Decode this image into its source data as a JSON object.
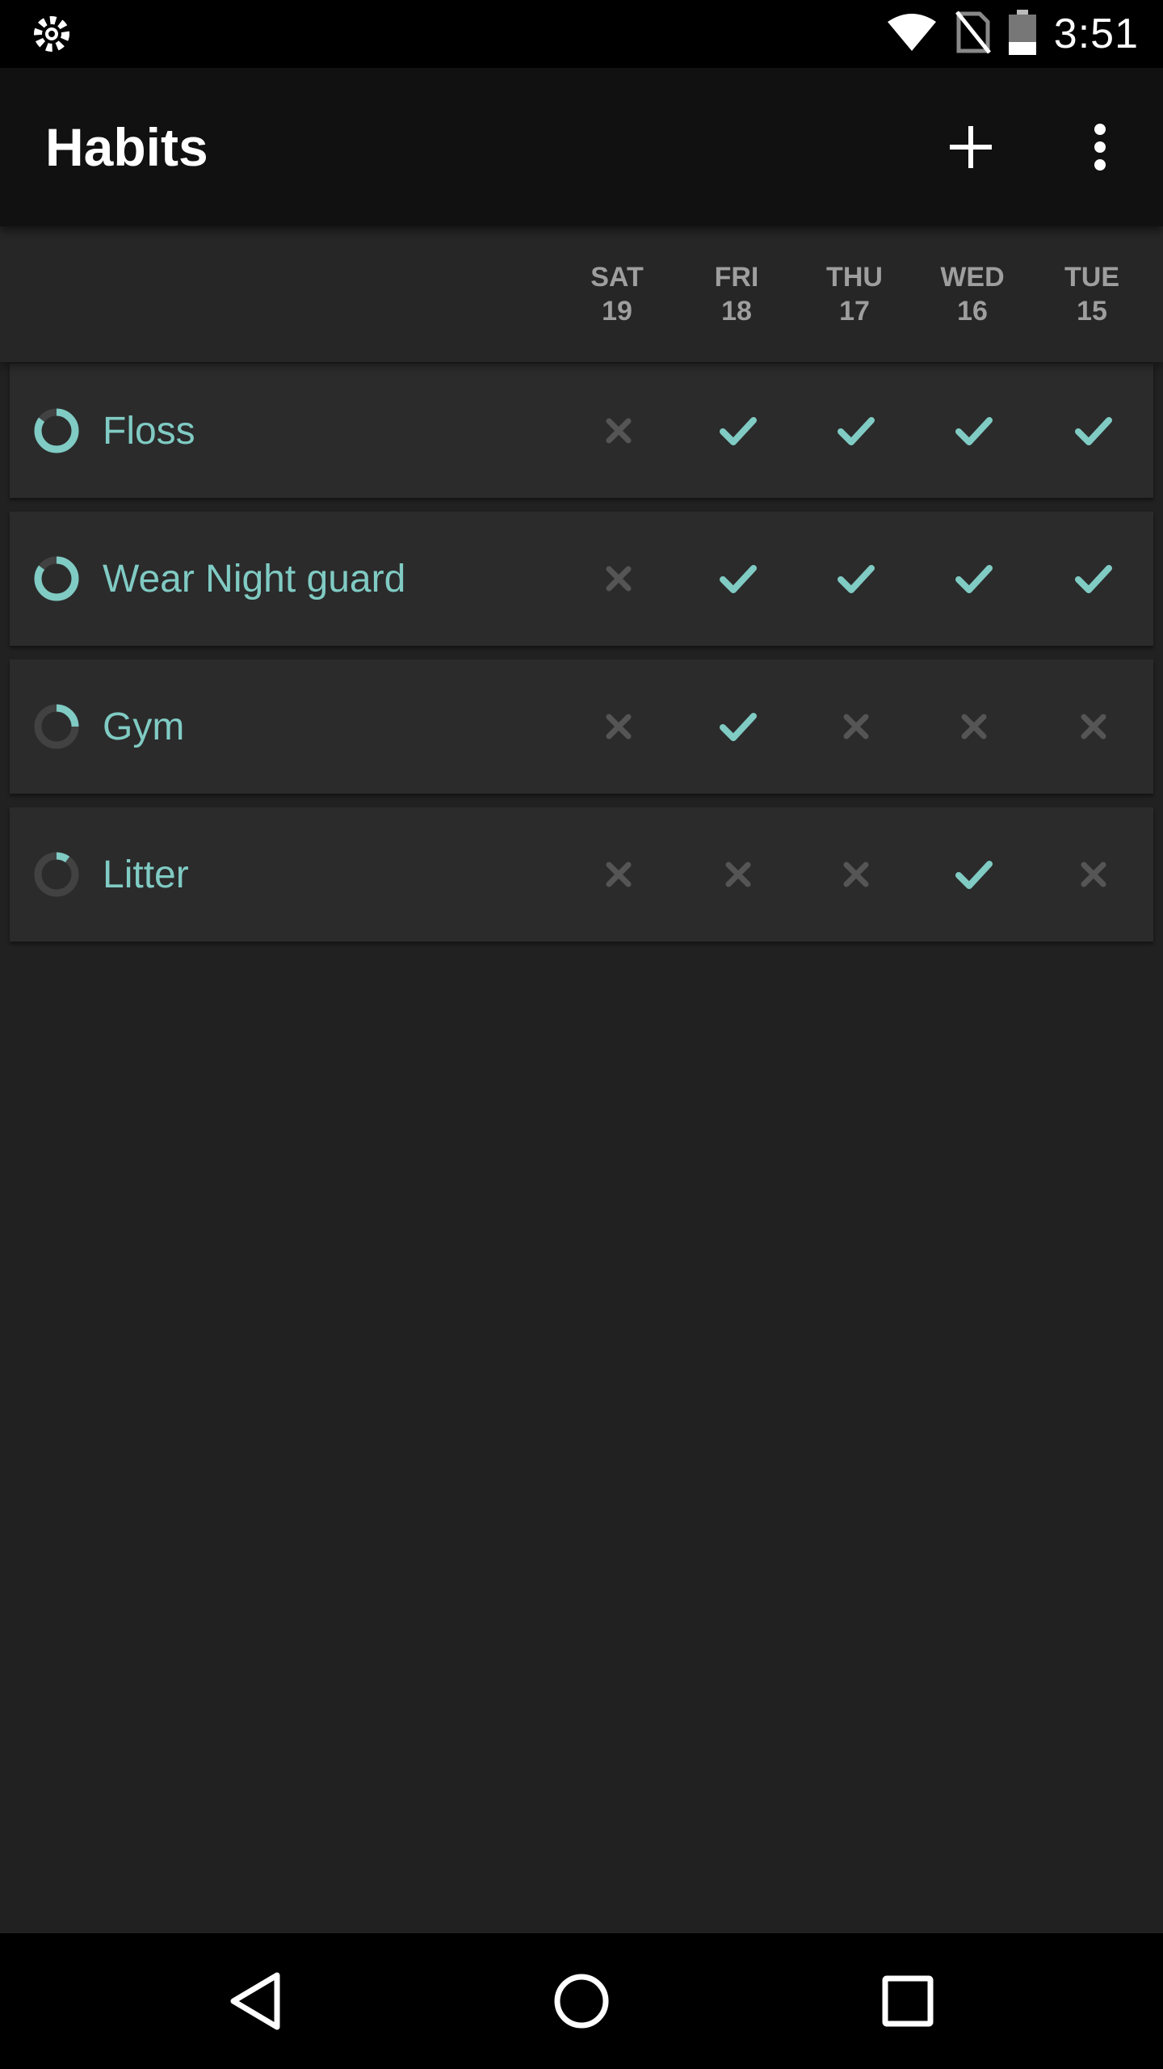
{
  "status_bar": {
    "time": "3:51",
    "icons": [
      "settings-gear-icon",
      "wifi-icon",
      "no-sim-icon",
      "battery-icon"
    ]
  },
  "app_bar": {
    "title": "Habits",
    "actions": [
      "add-icon",
      "more-vert-icon"
    ]
  },
  "days": [
    {
      "dow": "SAT",
      "date": "19"
    },
    {
      "dow": "FRI",
      "date": "18"
    },
    {
      "dow": "THU",
      "date": "17"
    },
    {
      "dow": "WED",
      "date": "16"
    },
    {
      "dow": "TUE",
      "date": "15"
    }
  ],
  "habits": [
    {
      "name": "Floss",
      "score": 0.85,
      "checks": [
        false,
        true,
        true,
        true,
        true
      ]
    },
    {
      "name": "Wear Night guard",
      "score": 0.85,
      "checks": [
        false,
        true,
        true,
        true,
        true
      ]
    },
    {
      "name": "Gym",
      "score": 0.25,
      "checks": [
        false,
        true,
        false,
        false,
        false
      ]
    },
    {
      "name": "Litter",
      "score": 0.1,
      "checks": [
        false,
        false,
        false,
        true,
        false
      ]
    }
  ],
  "colors": {
    "accent": "#80cbc4",
    "unchecked": "#555555",
    "ring_track": "#424242",
    "background": "#212121",
    "card": "#2b2b2b",
    "app_bar": "#111111"
  },
  "nav_bar": {
    "icons": [
      "back-icon",
      "home-icon",
      "recents-icon"
    ]
  }
}
